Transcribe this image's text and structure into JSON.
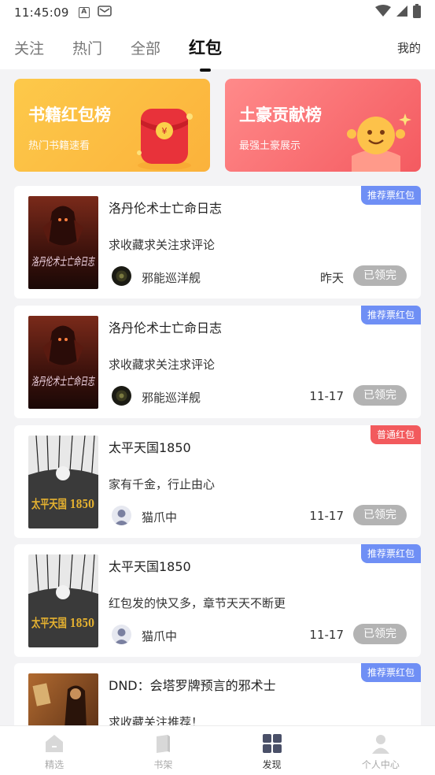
{
  "status_bar": {
    "time": "11:45:09",
    "icons": [
      "a-notification-icon",
      "mail-notification-icon",
      "wifi-icon",
      "signal-icon",
      "battery-icon"
    ]
  },
  "top_nav": {
    "tabs": [
      {
        "label": "关注",
        "active": false
      },
      {
        "label": "热门",
        "active": false
      },
      {
        "label": "全部",
        "active": false
      },
      {
        "label": "红包",
        "active": true
      }
    ],
    "mine": "我的"
  },
  "banners": [
    {
      "title": "书籍红包榜",
      "subtitle": "热门书籍速看",
      "color": "#fbb23b"
    },
    {
      "title": "土豪贡献榜",
      "subtitle": "最强土豪展示",
      "color": "#f45a60"
    }
  ],
  "cards": [
    {
      "tag": "推荐票红包",
      "tag_color": "blue",
      "title": "洛丹伦术士亡命日志",
      "desc": "求收藏求关注求评论",
      "user": "邪能巡洋舰",
      "date": "昨天",
      "status": "已领完",
      "cover": "dark"
    },
    {
      "tag": "推荐票红包",
      "tag_color": "blue",
      "title": "洛丹伦术士亡命日志",
      "desc": "求收藏求关注求评论",
      "user": "邪能巡洋舰",
      "date": "11-17",
      "status": "已领完",
      "cover": "dark"
    },
    {
      "tag": "普通红包",
      "tag_color": "red",
      "title": "太平天国1850",
      "desc": "家有千金，行止由心",
      "user": "猫爪中",
      "date": "11-17",
      "status": "已领完",
      "cover": "bw"
    },
    {
      "tag": "推荐票红包",
      "tag_color": "blue",
      "title": "太平天国1850",
      "desc": "红包发的快又多，章节天天不断更",
      "user": "猫爪中",
      "date": "11-17",
      "status": "已领完",
      "cover": "bw"
    },
    {
      "tag": "推荐票红包",
      "tag_color": "blue",
      "title": "DND：会塔罗牌预言的邪术士",
      "desc": "求收藏关注推荐！",
      "user": "",
      "date": "",
      "status": "",
      "cover": "sepia"
    }
  ],
  "cover_text": {
    "book1": "洛丹伦术士亡命日志",
    "book2": "太平天国 1850"
  },
  "bottom_nav": [
    {
      "label": "精选",
      "icon": "featured-icon",
      "active": false
    },
    {
      "label": "书架",
      "icon": "bookshelf-icon",
      "active": false
    },
    {
      "label": "发现",
      "icon": "discover-icon",
      "active": true
    },
    {
      "label": "个人中心",
      "icon": "profile-icon",
      "active": false
    }
  ],
  "colors": {
    "accent_blue": "#6f8ff5",
    "accent_red": "#f25a5d",
    "claimed_gray": "#b3b3b3"
  }
}
